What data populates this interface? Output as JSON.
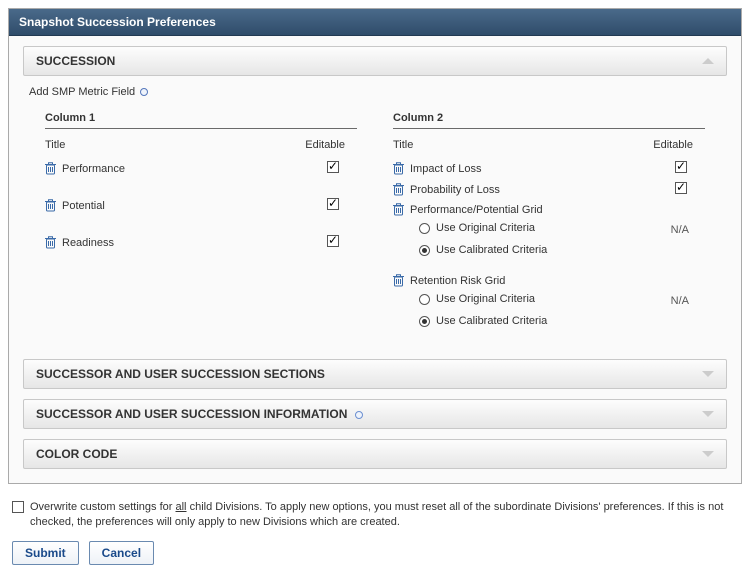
{
  "panel_title": "Snapshot Succession Preferences",
  "sections": {
    "succession": {
      "label": "SUCCESSION",
      "expanded": true
    },
    "successor_sections": {
      "label": "SUCCESSOR AND USER SUCCESSION SECTIONS",
      "expanded": false
    },
    "successor_info": {
      "label": "SUCCESSOR AND USER SUCCESSION INFORMATION",
      "expanded": false,
      "has_help": true
    },
    "color_code": {
      "label": "COLOR CODE",
      "expanded": false
    }
  },
  "add_link": "Add SMP Metric Field",
  "column_headers": {
    "col1": "Column 1",
    "col2": "Column 2",
    "title": "Title",
    "editable": "Editable"
  },
  "column1": [
    {
      "title": "Performance",
      "editable": true
    },
    {
      "title": "Potential",
      "editable": true
    },
    {
      "title": "Readiness",
      "editable": true
    }
  ],
  "column2_simple": [
    {
      "title": "Impact of Loss",
      "editable": true
    },
    {
      "title": "Probability of Loss",
      "editable": true
    }
  ],
  "column2_grids": [
    {
      "title": "Performance/Potential Grid",
      "options": [
        {
          "label": "Use Original Criteria",
          "selected": false,
          "editable_text": "N/A"
        },
        {
          "label": "Use Calibrated Criteria",
          "selected": true,
          "editable_text": ""
        }
      ]
    },
    {
      "title": "Retention Risk Grid",
      "options": [
        {
          "label": "Use Original Criteria",
          "selected": false,
          "editable_text": "N/A"
        },
        {
          "label": "Use Calibrated Criteria",
          "selected": true,
          "editable_text": ""
        }
      ]
    }
  ],
  "overwrite": {
    "checked": false,
    "pre": "Overwrite custom settings for ",
    "all": "all",
    "post": " child Divisions. To apply new options, you must reset all of the subordinate Divisions' preferences. If this is not checked, the preferences will only apply to new Divisions which are created."
  },
  "buttons": {
    "submit": "Submit",
    "cancel": "Cancel"
  }
}
